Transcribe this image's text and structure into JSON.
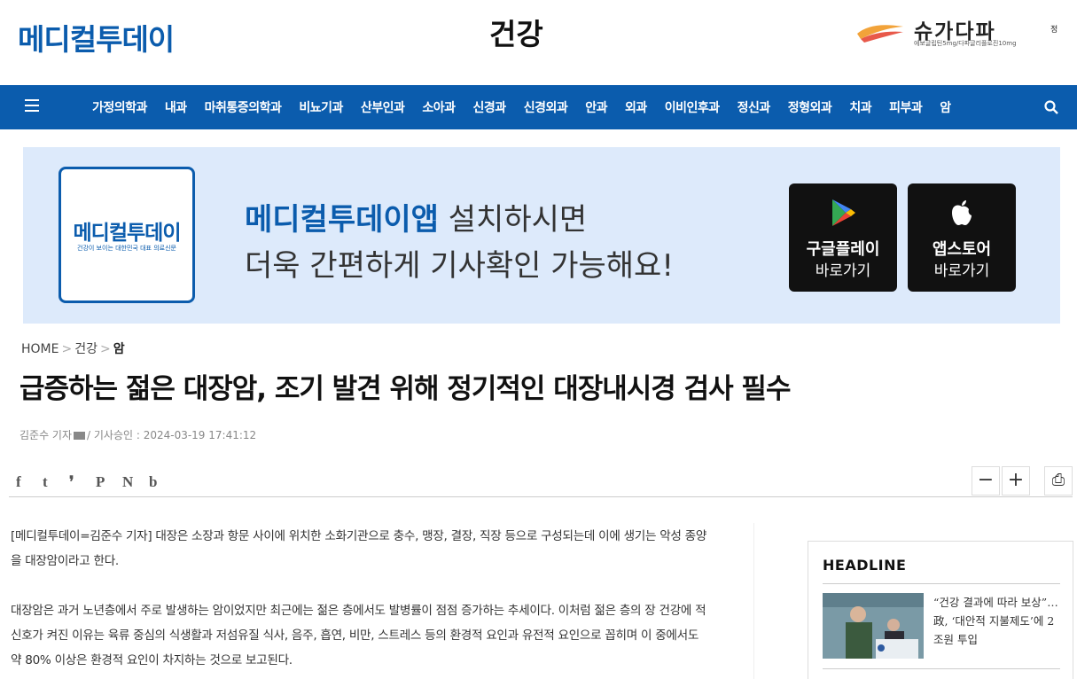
{
  "header": {
    "logo": "메디컬투데이",
    "section": "건강",
    "ad": {
      "title": "슈가다파",
      "mark": "정",
      "sub": "에보글립틴5mg/다파글리플로진10mg"
    }
  },
  "nav": {
    "items": [
      "가정의학과",
      "내과",
      "마취통증의학과",
      "비뇨기과",
      "산부인과",
      "소아과",
      "신경과",
      "신경외과",
      "안과",
      "외과",
      "이비인후과",
      "정신과",
      "정형외과",
      "치과",
      "피부과",
      "암"
    ]
  },
  "banner": {
    "logo_name": "메디컬투데이",
    "logo_tagline": "건강이 보이는 대한민국 대표 의료신문",
    "line1_strong": "메디컬투데이앱",
    "line1_rest": " 설치하시면",
    "line2": "더욱 간편하게 기사확인 가능해요!",
    "google": {
      "title": "구글플레이",
      "sub": "바로가기"
    },
    "apple": {
      "title": "앱스토어",
      "sub": "바로가기"
    }
  },
  "breadcrumb": {
    "home": "HOME",
    "sep": ">",
    "section": "건강",
    "current": "암"
  },
  "article": {
    "title": "급증하는 젊은 대장암, 조기 발견 위해 정기적인 대장내시경 검사 필수",
    "author": "김준수 기자",
    "approved": "/ 기사승인 : 2024-03-19 17:41:12",
    "paragraphs": [
      "[메디컬투데이=김준수 기자] 대장은 소장과 항문 사이에 위치한 소화기관으로 충수, 맹장, 결장, 직장 등으로 구성되는데 이에 생기는 악성 종양을 대장암이라고 한다.",
      "대장암은 과거 노년층에서 주로 발생하는 암이었지만 최근에는 젊은 층에서도 발병률이 점점 증가하는 추세이다. 이처럼 젊은 층의 장 건강에 적신호가 켜진 이유는 육류 중심의 식생활과 저섬유질 식사, 음주, 흡연, 비만, 스트레스 등의 환경적 요인과 유전적 요인으로 꼽히며 이 중에서도 약 80% 이상은 환경적 요인이 차지하는 것으로 보고된다."
    ]
  },
  "share": {
    "icons": [
      "f",
      "t",
      "❜",
      "P",
      "N",
      "b"
    ],
    "zoom_out": "−",
    "zoom_in": "+",
    "print": "⎙"
  },
  "sidebar": {
    "title": "HEADLINE",
    "items": [
      {
        "text": "“건강 결과에 따라 보상”…政, ‘대안적 지불제도’에 2조원 투입"
      }
    ]
  }
}
